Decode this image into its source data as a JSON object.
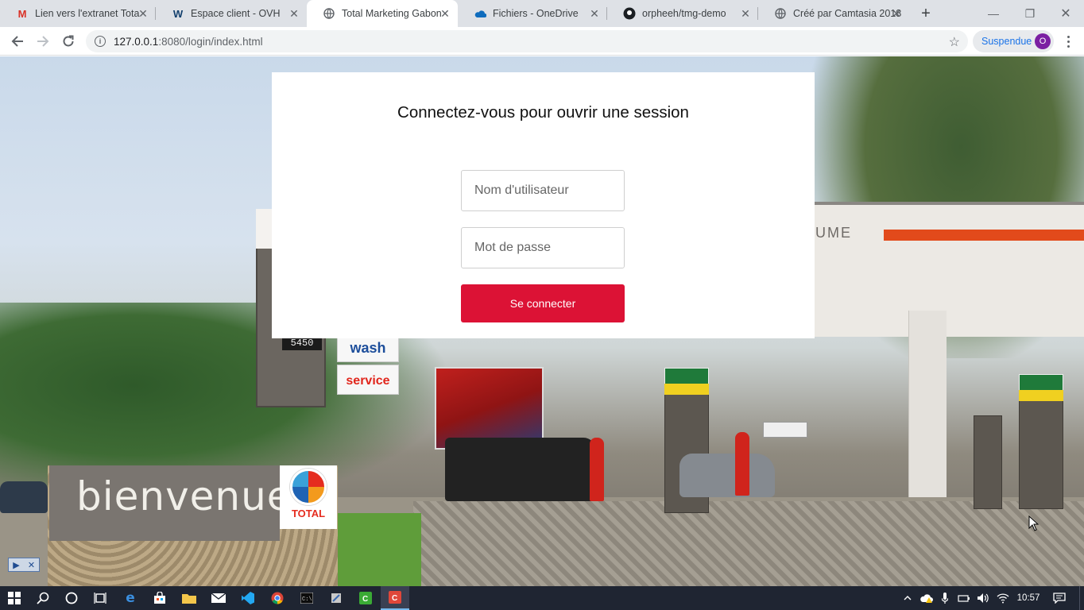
{
  "browser": {
    "tabs": [
      {
        "title": "Lien vers l'extranet Tota",
        "icon": "gmail-icon",
        "active": false
      },
      {
        "title": "Espace client - OVH",
        "icon": "ovh-icon",
        "active": false
      },
      {
        "title": "Total Marketing Gabon",
        "icon": "globe-icon",
        "active": true
      },
      {
        "title": "Fichiers - OneDrive",
        "icon": "onedrive-icon",
        "active": false
      },
      {
        "title": "orpheeh/tmg-demo",
        "icon": "github-icon",
        "active": false
      },
      {
        "title": "Créé par Camtasia 2018",
        "icon": "globe-icon",
        "active": false
      }
    ],
    "address": {
      "host": "127.0.0.1",
      "rest": ":8080/login/index.html"
    },
    "profile": {
      "label": "Suspendue",
      "initial": "O",
      "color": "#7b1fa2"
    }
  },
  "scene": {
    "welcome": "bienvenue",
    "brand": "TOTAL",
    "canopy_text": "UME",
    "price": "5450",
    "wash": "wash",
    "service": "service"
  },
  "login": {
    "title": "Connectez-vous pour ouvrir une session",
    "username_placeholder": "Nom d'utilisateur",
    "password_placeholder": "Mot de passe",
    "submit_label": "Se connecter",
    "accent": "#dc1235"
  },
  "taskbar": {
    "time": "10:57"
  }
}
